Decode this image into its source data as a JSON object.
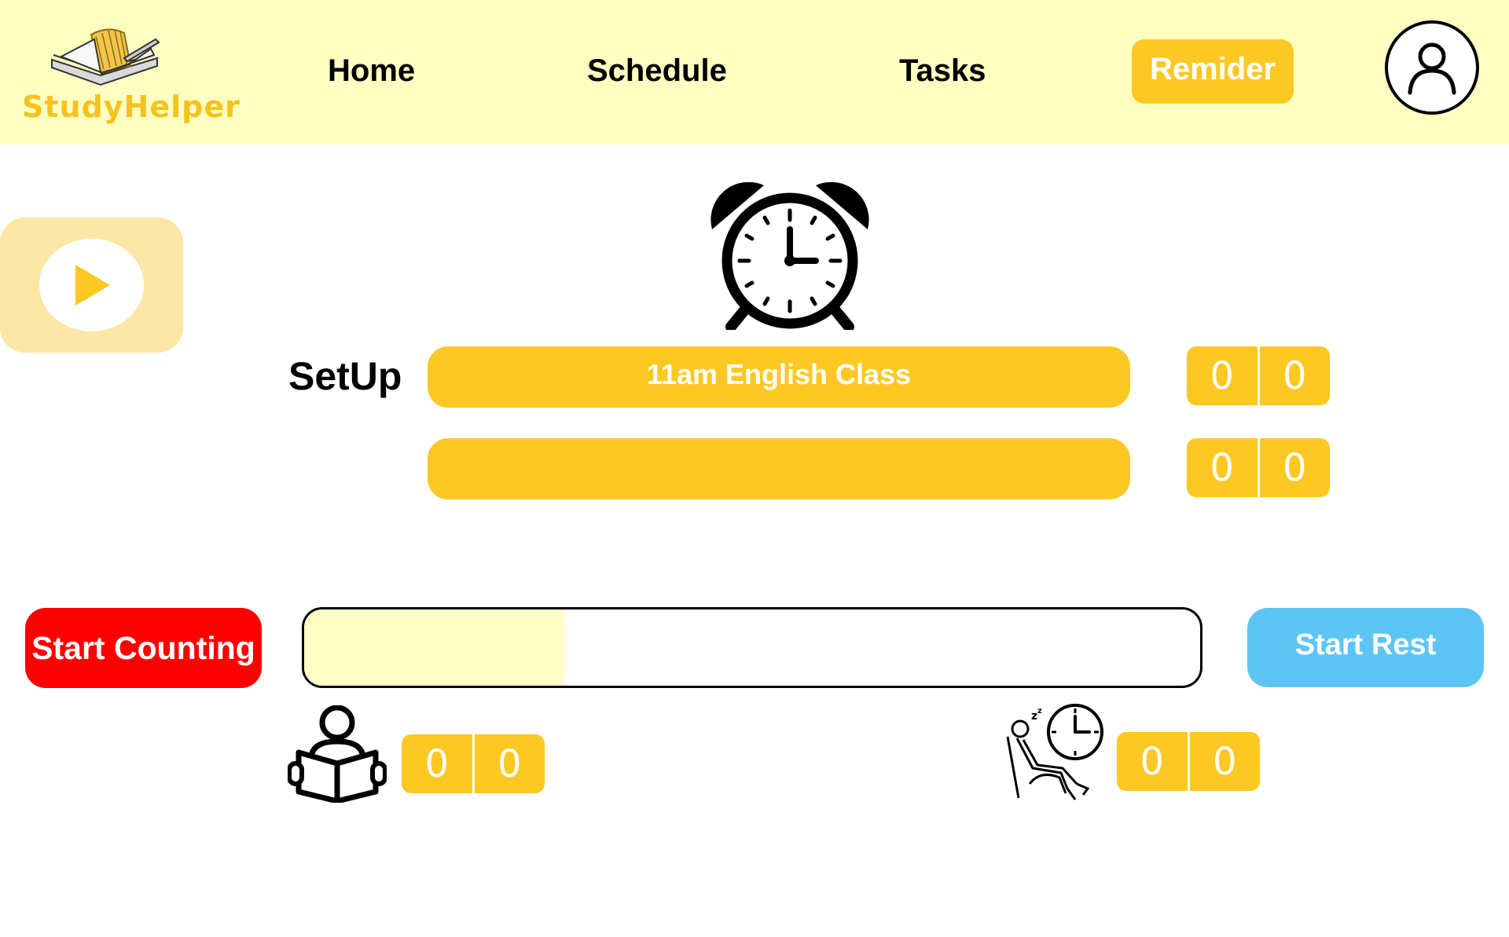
{
  "app": {
    "logo_text": "StudyHelper"
  },
  "nav": {
    "items": [
      {
        "label": "Home"
      },
      {
        "label": "Schedule"
      },
      {
        "label": "Tasks"
      }
    ],
    "reminder_label": "Remider"
  },
  "icons": {
    "logo": "book-pen-icon",
    "avatar": "user-avatar-icon",
    "play": "play-icon",
    "alarm": "alarm-clock-icon",
    "study": "reading-person-icon",
    "rest": "resting-person-clock-icon"
  },
  "setup": {
    "label": "SetUp",
    "tasks": [
      {
        "label": "11am English Class",
        "digits": [
          "0",
          "0"
        ]
      },
      {
        "label": "",
        "digits": [
          "0",
          "0"
        ]
      }
    ]
  },
  "timer": {
    "start_counting_label": "Start Counting",
    "start_rest_label": "Start Rest",
    "progress_fraction": 0.29,
    "study_digits": [
      "0",
      "0"
    ],
    "rest_digits": [
      "0",
      "0"
    ]
  },
  "colors": {
    "header_bg": "#ffffc2",
    "accent_yellow": "#fdc824",
    "start_counting": "#ff0000",
    "start_rest": "#5dc5f3",
    "play_card": "#fde7a6",
    "progress_fill": "#ffffc6"
  }
}
